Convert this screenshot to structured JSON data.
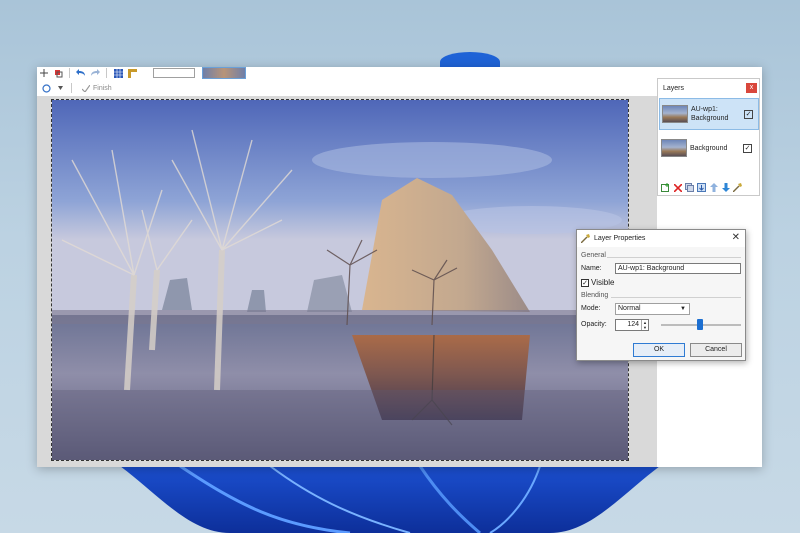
{
  "toolbar": {
    "finish_label": "Finish"
  },
  "layers_panel": {
    "title": "Layers",
    "close_glyph": "x",
    "layers": [
      {
        "name": "AU-wp1: Background",
        "visible": true,
        "selected": true
      },
      {
        "name": "Background",
        "visible": true,
        "selected": false
      }
    ]
  },
  "dialog": {
    "title": "Layer Properties",
    "close_glyph": "✕",
    "general_label": "General",
    "name_label": "Name:",
    "name_value": "AU-wp1: Background",
    "visible_label": "Visible",
    "visible_checked": true,
    "blending_label": "Blending",
    "mode_label": "Mode:",
    "mode_value": "Normal",
    "opacity_label": "Opacity:",
    "opacity_value": "124",
    "ok_label": "OK",
    "cancel_label": "Cancel"
  },
  "colors": {
    "accent": "#1d6fd1",
    "close_red": "#d9473c",
    "selection": "#cde3f7"
  }
}
